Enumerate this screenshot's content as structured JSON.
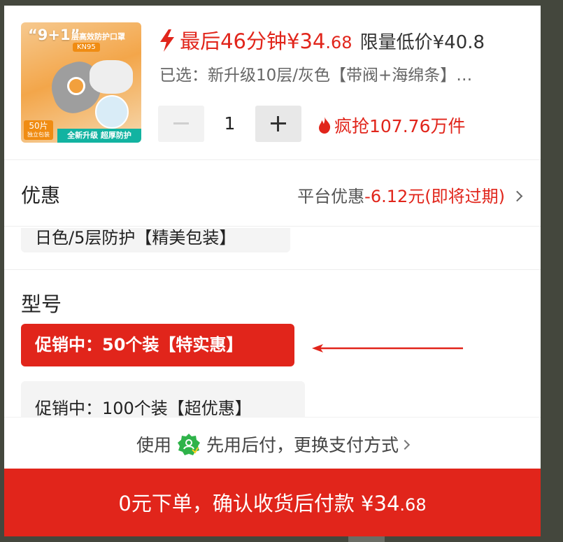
{
  "product": {
    "thumb_brand": "“9+1”",
    "thumb_subtitle": "层高效防护口罩",
    "thumb_kn": "KN95",
    "thumb_count": "50片",
    "thumb_count_sub": "独立包装",
    "thumb_ribbon": "全新升级 超厚防护",
    "flash_prefix": "最后46分钟¥34",
    "flash_cents": ".68",
    "limit_price": "限量低价¥40.8",
    "selected": "已选：新升级10层/灰色【带阀+海绵条】…",
    "quantity": "1",
    "hot_sale": "疯抢107.76万件"
  },
  "promo": {
    "label": "优惠",
    "value_prefix": "平台优惠",
    "value_red": "-6.12元(即将过期)"
  },
  "options": {
    "partial_option": "日色/5层防护【精美包装】",
    "model_label": "型号",
    "selected_option": "促销中：50个装【特实惠】",
    "other_option": "促销中：100个装【超优惠】"
  },
  "payment": {
    "prefix": "使用",
    "suffix": "先用后付，更换支付方式"
  },
  "cta": {
    "label": "0元下单，确认收货后付款 ¥34",
    "cents": ".68"
  },
  "colors": {
    "accent": "#e1251b",
    "pay_logo": "#2fb34a"
  }
}
